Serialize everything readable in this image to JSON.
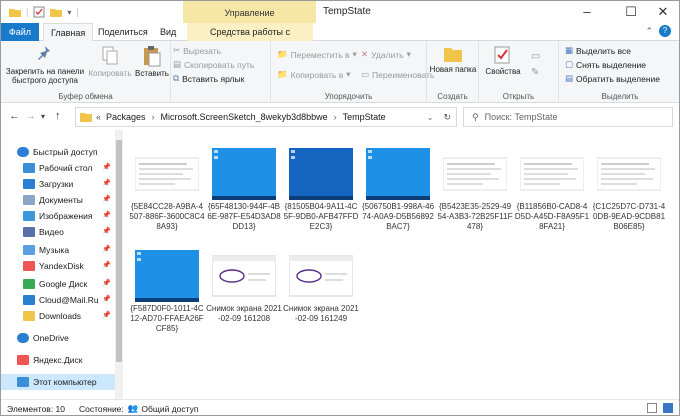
{
  "window": {
    "title": "TempState",
    "context_tab_header": "Управление",
    "minimize": "–",
    "maximize": "☐",
    "close": "✕"
  },
  "ribbon_tabs": [
    "Файл",
    "Главная",
    "Поделиться",
    "Вид",
    "Средства работы с рисунками"
  ],
  "ribbon": {
    "clipboard": {
      "pin_label": "Закрепить на панели быстрого доступа",
      "copy_label": "Копировать",
      "paste_label": "Вставить",
      "cut_label": "Вырезать",
      "copy_path_label": "Скопировать путь",
      "paste_shortcut_label": "Вставить ярлык",
      "group_label": "Буфер обмена"
    },
    "organize": {
      "move_to_label": "Переместить в",
      "copy_to_label": "Копировать в",
      "delete_label": "Удалить",
      "rename_label": "Переименовать",
      "group_label": "Упорядочить"
    },
    "new": {
      "new_folder_label": "Новая папка",
      "group_label": "Создать"
    },
    "open": {
      "properties_label": "Свойства",
      "group_label": "Открыть"
    },
    "select": {
      "select_all_label": "Выделить все",
      "select_none_label": "Снять выделение",
      "invert_label": "Обратить выделение",
      "group_label": "Выделить"
    }
  },
  "address": {
    "overflow": "«",
    "segments": [
      "Packages",
      "Microsoft.ScreenSketch_8wekyb3d8bbwe",
      "TempState"
    ],
    "search_placeholder": "Поиск: TempState"
  },
  "nav_pane": {
    "items": [
      {
        "label": "Быстрый доступ",
        "icon": "star-icon",
        "pinned": false
      },
      {
        "label": "Рабочий стол",
        "icon": "desktop-icon",
        "pinned": true
      },
      {
        "label": "Загрузки",
        "icon": "download-icon",
        "pinned": true
      },
      {
        "label": "Документы",
        "icon": "documents-icon",
        "pinned": true
      },
      {
        "label": "Изображения",
        "icon": "pictures-icon",
        "pinned": true
      },
      {
        "label": "Видео",
        "icon": "video-icon",
        "pinned": true
      },
      {
        "label": "Музыка",
        "icon": "music-icon",
        "pinned": true
      },
      {
        "label": "YandexDisk",
        "icon": "yandex-disk-icon",
        "pinned": true
      },
      {
        "label": "Google Диск",
        "icon": "google-drive-icon",
        "pinned": true
      },
      {
        "label": "Cloud@Mail.Ru",
        "icon": "cloud-mail-icon",
        "pinned": true
      },
      {
        "label": "Downloads",
        "icon": "folder-icon",
        "pinned": true
      },
      {
        "label": "OneDrive",
        "icon": "onedrive-icon",
        "pinned": false
      },
      {
        "label": "Яндекс.Диск",
        "icon": "yandex-disk-icon",
        "pinned": false
      },
      {
        "label": "Этот компьютер",
        "icon": "this-pc-icon",
        "pinned": false
      }
    ],
    "pin_glyph": "📌"
  },
  "files": [
    {
      "name": "{5E84CC28-A9BA-4507-886F-3600C8C48A93}",
      "thumb": "doc"
    },
    {
      "name": "{65F48130-944F-4B6E-987F-E54D3AD8DD13}",
      "thumb": "blue"
    },
    {
      "name": "{81505B04-9A11-4C5F-9DB0-AFB47FFDE2C3}",
      "thumb": "darkblue"
    },
    {
      "name": "{506750B1-998A-4674-A0A9-D5B56892BAC7}",
      "thumb": "blue"
    },
    {
      "name": "{B5423E35-2529-4954-A3B3-72B25F11F478}",
      "thumb": "doc"
    },
    {
      "name": "{B11856B0-CAD8-4D5D-A45D-F8A95F18FA21}",
      "thumb": "doc"
    },
    {
      "name": "{C1C25D7C-D731-40DB-9EAD-9CDB81B06E85}",
      "thumb": "doc"
    },
    {
      "name": "{F587D0F0-1011-4C12-AD70-FFAEA26FCF85}",
      "thumb": "blue"
    },
    {
      "name": "Снимок экрана 2021-02-09 161208",
      "thumb": "sketch"
    },
    {
      "name": "Снимок экрана 2021-02-09 161249",
      "thumb": "sketch"
    }
  ],
  "status": {
    "count_label": "Элементов: 10",
    "state_label": "Состояние:",
    "share_label": "Общий доступ"
  },
  "colors": {
    "file_tab": "#1979ca",
    "context_tab": "#f6e7a6",
    "selected_nav": "#cce8ff",
    "thumb_blue": "#1e90e6",
    "thumb_darkblue": "#1565c0"
  }
}
